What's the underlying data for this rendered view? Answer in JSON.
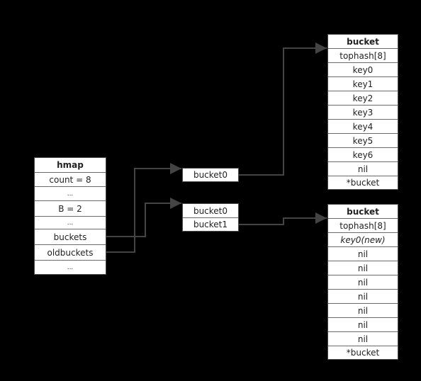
{
  "hmap": {
    "title": "hmap",
    "fields": [
      "count = 8",
      "...",
      "B = 2",
      "...",
      "buckets",
      "oldbuckets",
      "..."
    ]
  },
  "old_bucket_array": {
    "items": [
      "bucket0"
    ]
  },
  "new_bucket_array": {
    "items": [
      "bucket0",
      "bucket1"
    ]
  },
  "bucket_old": {
    "title": "bucket",
    "fields": [
      "tophash[8]",
      "key0",
      "key1",
      "key2",
      "key3",
      "key4",
      "key5",
      "key6",
      "nil",
      "*bucket"
    ]
  },
  "bucket_new": {
    "title": "bucket",
    "fields": [
      "tophash[8]",
      "key0(new)",
      "nil",
      "nil",
      "nil",
      "nil",
      "nil",
      "nil",
      "nil",
      "*bucket"
    ]
  },
  "colors": {
    "background": "#000000",
    "line": "#444444",
    "box": "#ffffff"
  }
}
